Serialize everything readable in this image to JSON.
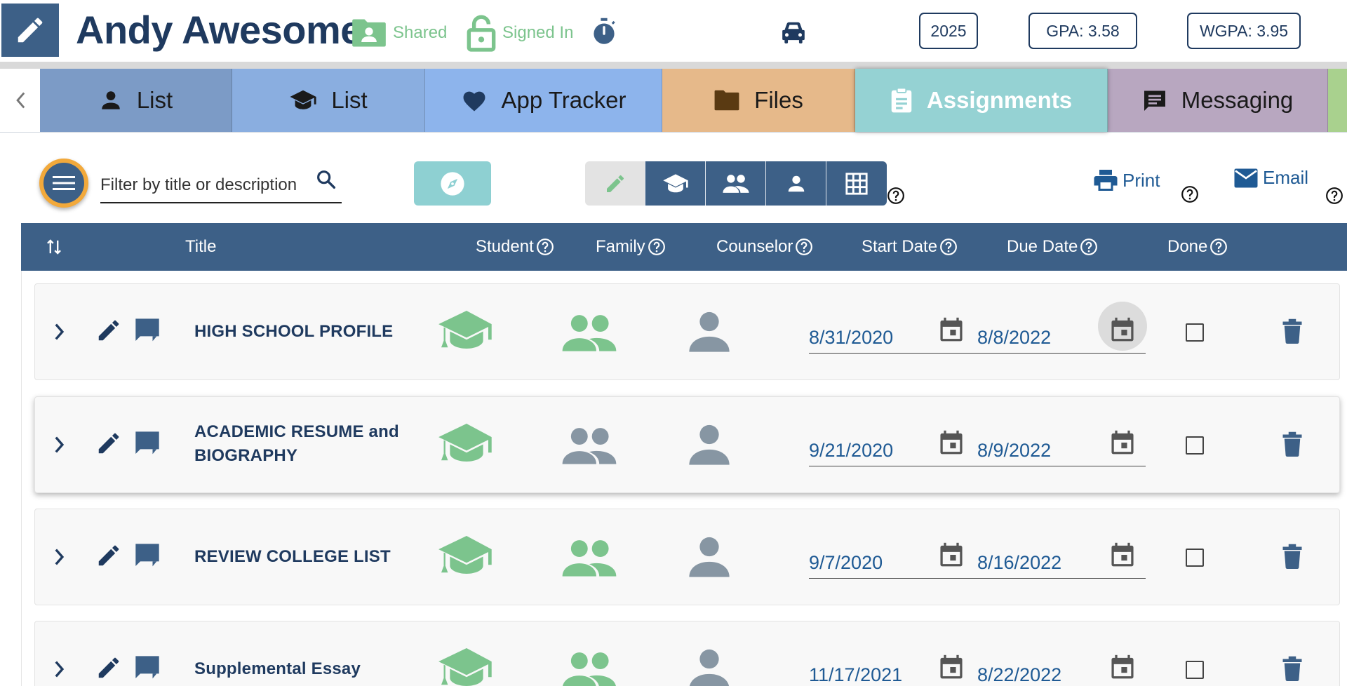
{
  "header": {
    "student_name": "Andy Awesome",
    "shared_label": "Shared",
    "signed_in_label": "Signed In",
    "grad_year": "2025",
    "gpa": "GPA: 3.58",
    "wgpa": "WGPA: 3.95"
  },
  "tabs": [
    {
      "label": "List",
      "icon": "person-icon",
      "color": "#7c9bc6",
      "active": false
    },
    {
      "label": "List",
      "icon": "graduation-cap-icon",
      "color": "#8aaee0",
      "active": false
    },
    {
      "label": "App Tracker",
      "icon": "heart-icon",
      "color": "#8db4ec",
      "active": false
    },
    {
      "label": "Files",
      "icon": "folder-icon",
      "color": "#e6b98a",
      "active": false
    },
    {
      "label": "Assignments",
      "icon": "clipboard-icon",
      "color": "#95d2d3",
      "active": true
    },
    {
      "label": "Messaging",
      "icon": "chat-icon",
      "color": "#b8a7c0",
      "active": false
    }
  ],
  "toolbar": {
    "filter_placeholder": "Filter by title or description",
    "print_label": "Print",
    "email_label": "Email"
  },
  "table": {
    "columns": {
      "title": "Title",
      "student": "Student",
      "family": "Family",
      "counselor": "Counselor",
      "start_date": "Start Date",
      "due_date": "Due Date",
      "done": "Done"
    },
    "rows": [
      {
        "title": "HIGH SCHOOL PROFILE",
        "student_done": true,
        "family_done": true,
        "counselor_done": false,
        "start_date": "8/31/2020",
        "due_date": "8/8/2022",
        "done": false
      },
      {
        "title": "ACADEMIC RESUME and BIOGRAPHY",
        "student_done": true,
        "family_done": false,
        "counselor_done": false,
        "start_date": "9/21/2020",
        "due_date": "8/9/2022",
        "done": false
      },
      {
        "title": "REVIEW COLLEGE LIST",
        "student_done": true,
        "family_done": true,
        "counselor_done": false,
        "start_date": "9/7/2020",
        "due_date": "8/16/2022",
        "done": false
      },
      {
        "title": "Supplemental Essay",
        "student_done": true,
        "family_done": true,
        "counselor_done": false,
        "start_date": "11/17/2021",
        "due_date": "8/22/2022",
        "done": false
      }
    ]
  },
  "colors": {
    "navy": "#3d6087",
    "done_green": "#7cc48d",
    "pending_grey": "#8796a3",
    "menu_orange": "#f2a93b"
  }
}
